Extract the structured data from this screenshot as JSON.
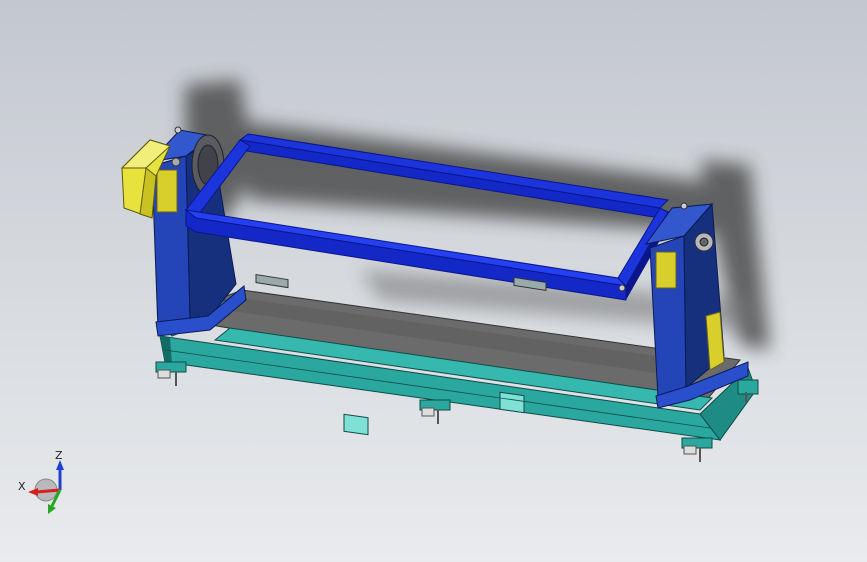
{
  "viewport": {
    "background_top": "#c3c8ce",
    "background_bottom": "#e9ebee",
    "colors": {
      "frame_blue": "#1428c8",
      "frame_blue_dark": "#0a168a",
      "column_blue": "#2445b8",
      "column_blue_dark": "#16307e",
      "base_teal": "#2aa79e",
      "base_teal_dark": "#136b66",
      "base_floor": "#6b6b6b",
      "motor_yellow": "#e8e23c",
      "shadow": "#3b3b3b"
    }
  },
  "triad": {
    "x_label": "X",
    "y_label": "Y",
    "z_label": "Z",
    "colors": {
      "x": "#d42020",
      "y": "#22a822",
      "z": "#2040d0"
    }
  }
}
